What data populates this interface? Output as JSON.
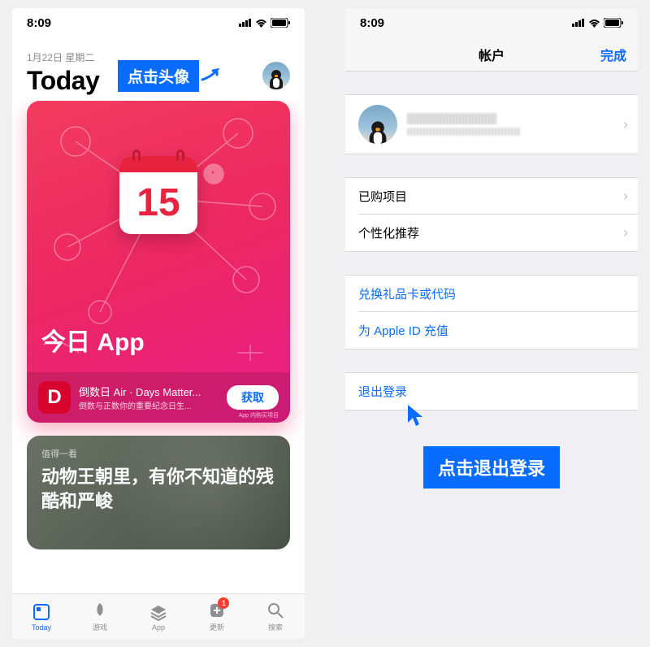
{
  "status": {
    "time": "8:09"
  },
  "left": {
    "date": "1月22日 星期二",
    "title": "Today",
    "callout": "点击头像",
    "card1": {
      "calendar_num": "15",
      "title": "今日 App",
      "app_letter": "D",
      "app_name": "倒数日 Air · Days Matter...",
      "app_sub": "倒数与正数你的重要纪念日生...",
      "get": "获取",
      "iap": "App 内购买项目"
    },
    "card2": {
      "eyebrow": "值得一看",
      "title": "动物王朝里，有你不知道的残酷和严峻"
    },
    "tabs": {
      "today": "Today",
      "games": "游戏",
      "apps": "App",
      "updates": "更新",
      "updates_badge": "1",
      "search": "搜索"
    }
  },
  "right": {
    "nav_title": "帐户",
    "nav_done": "完成",
    "purchased": "已购项目",
    "personalized": "个性化推荐",
    "redeem": "兑换礼品卡或代码",
    "add_funds": "为 Apple ID 充值",
    "sign_out": "退出登录",
    "callout": "点击退出登录"
  }
}
